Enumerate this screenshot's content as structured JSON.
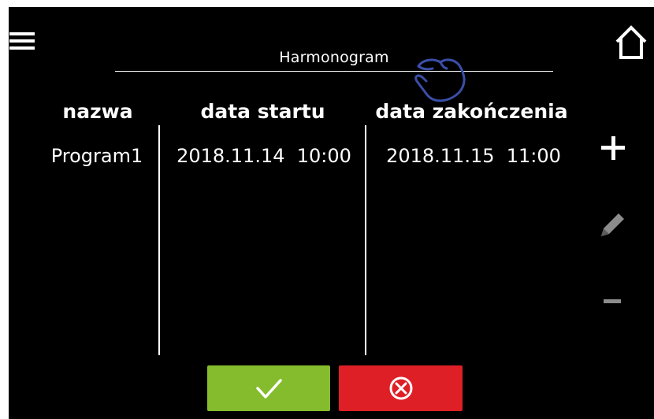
{
  "header": {
    "title": "Harmonogram",
    "menu_icon": "hamburger-menu-icon",
    "home_icon": "home-icon",
    "gesture_icon": "tap-hand-icon"
  },
  "table": {
    "columns": [
      "nazwa",
      "data startu",
      "data zakończenia"
    ],
    "rows": [
      {
        "name": "Program1",
        "start": "2018.11.14  10:00",
        "end": "2018.11.15  11:00"
      }
    ]
  },
  "side_actions": {
    "add_icon": "plus-icon",
    "edit_icon": "pencil-icon",
    "remove_icon": "minus-icon"
  },
  "footer": {
    "confirm_icon": "checkmark-icon",
    "cancel_icon": "circle-x-icon"
  },
  "colors": {
    "background": "#000000",
    "text": "#ffffff",
    "confirm": "#84bc2d",
    "cancel": "#df1f26",
    "disabled_icon": "#8c8c8c",
    "hand_outline": "#3a4fa8"
  }
}
